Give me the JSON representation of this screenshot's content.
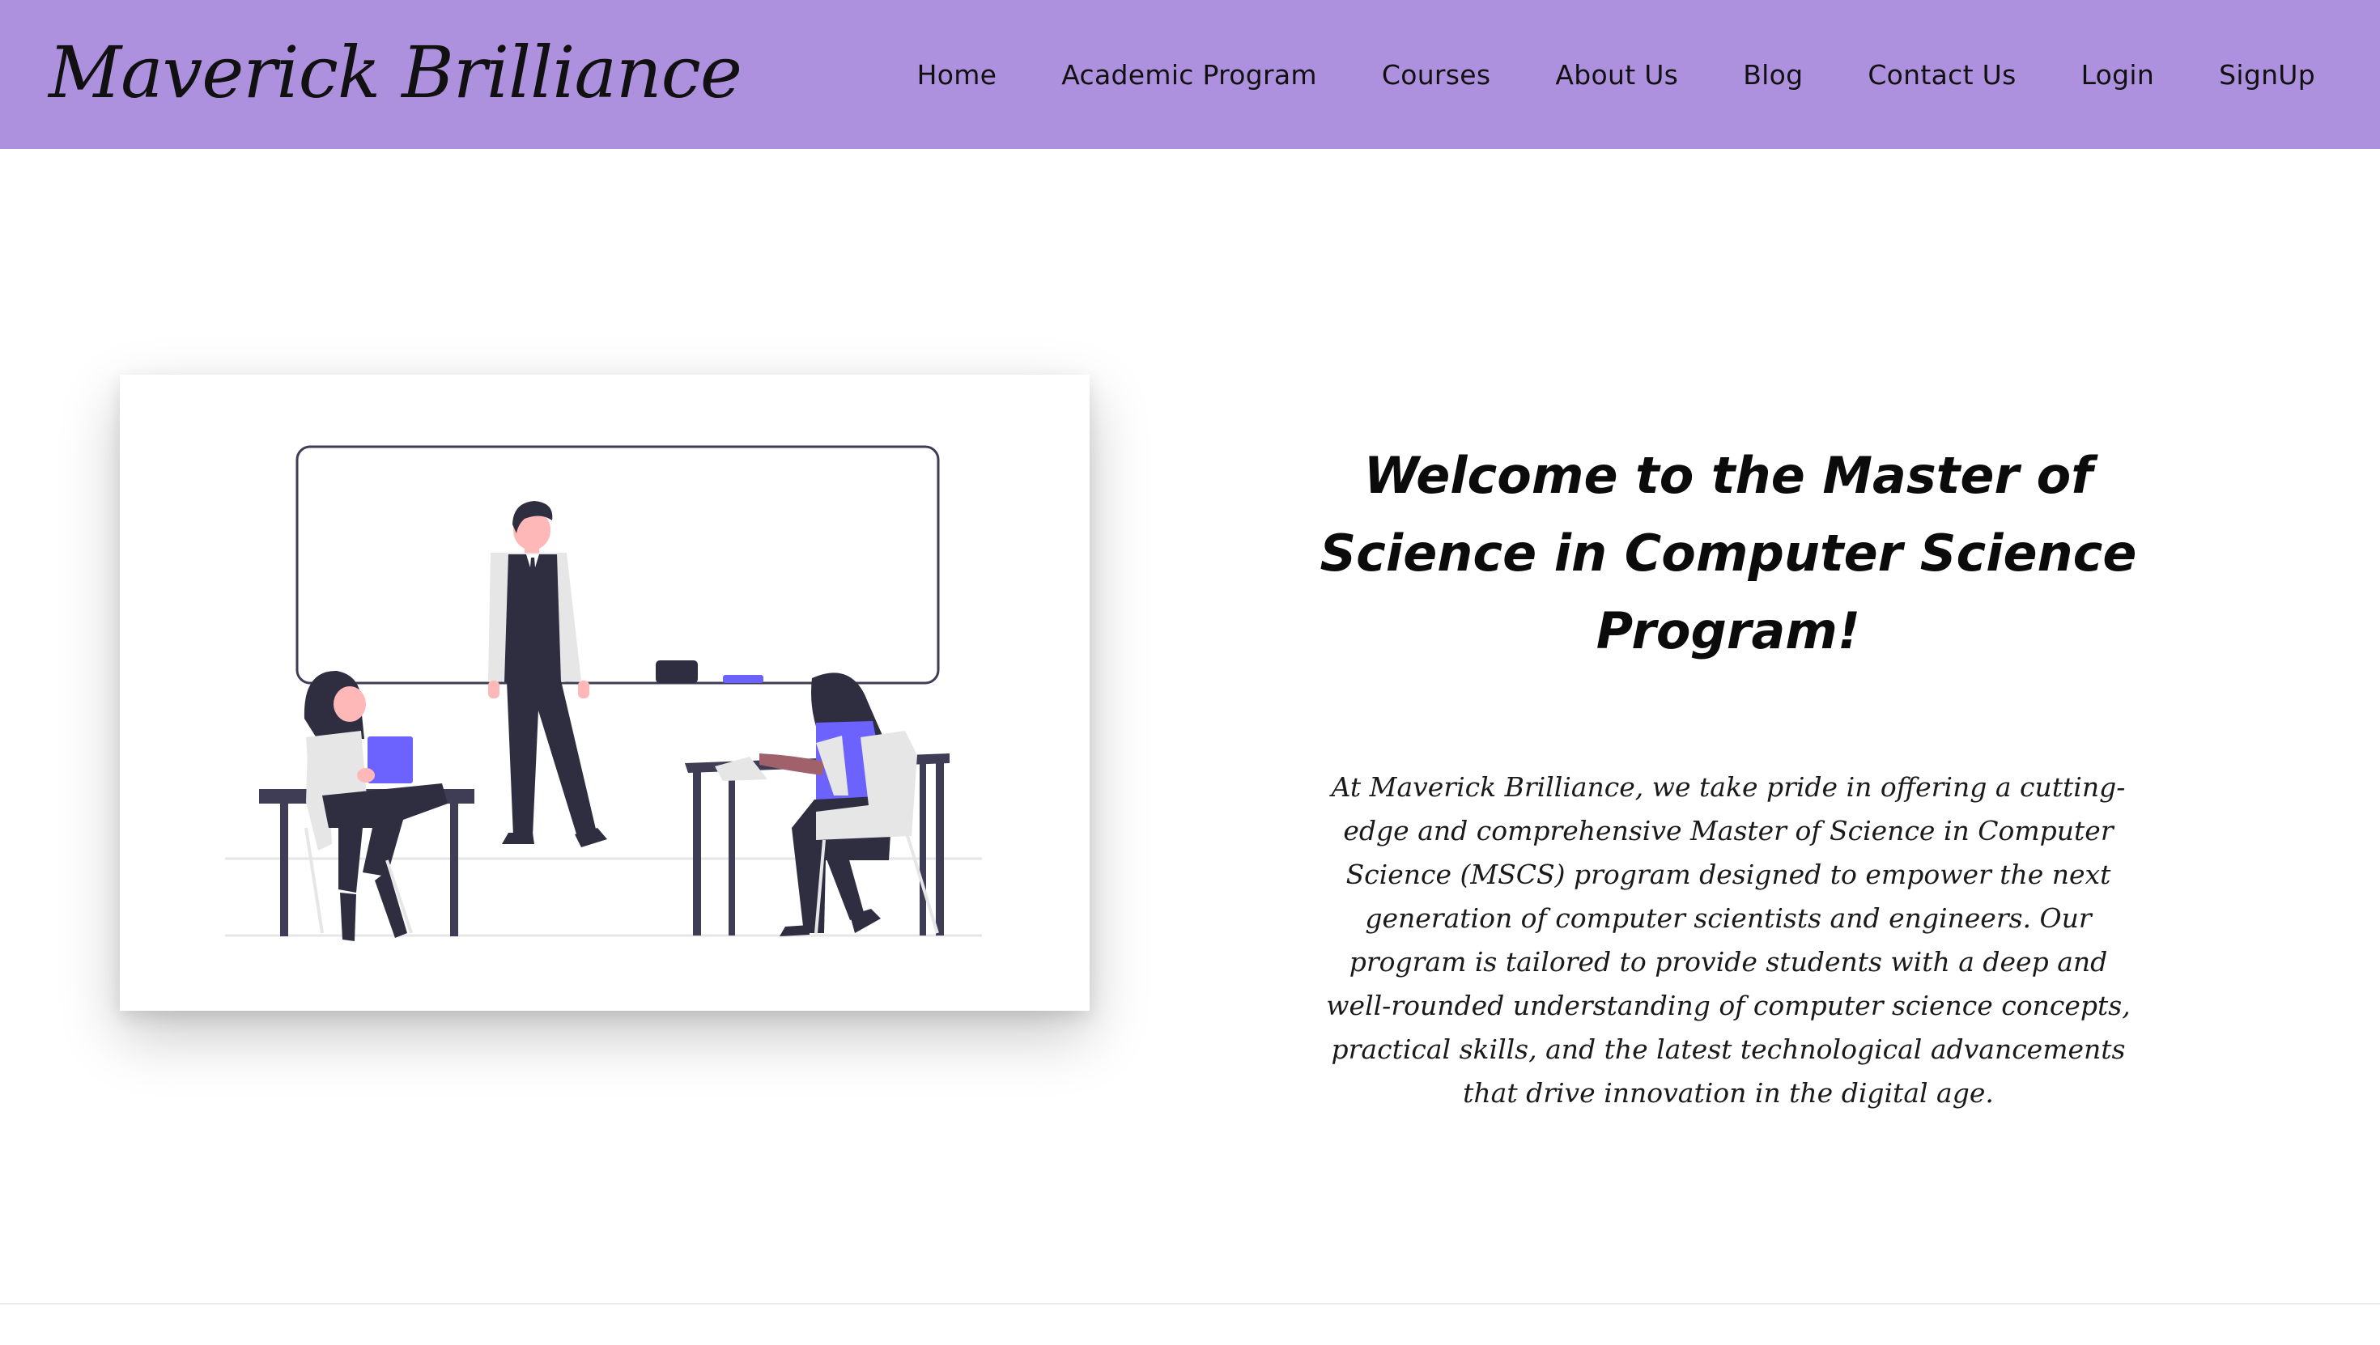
{
  "brand": {
    "name": "Maverick Brilliance"
  },
  "nav": {
    "items": [
      {
        "label": "Home"
      },
      {
        "label": "Academic Program"
      },
      {
        "label": "Courses"
      },
      {
        "label": "About Us"
      },
      {
        "label": "Blog"
      },
      {
        "label": "Contact Us"
      },
      {
        "label": "Login"
      },
      {
        "label": "SignUp"
      }
    ]
  },
  "hero": {
    "title": "Welcome to the Master of Science in Computer Science Program!",
    "body": "At Maverick Brilliance, we take pride in offering a cutting-edge and comprehensive Master of Science in Computer Science (MSCS) program designed to empower the next generation of computer scientists and engineers. Our program is tailored to provide students with a deep and well-rounded understanding of computer science concepts, practical skills, and the latest technological advancements that drive innovation in the digital age."
  },
  "colors": {
    "navbar": "#ae91de",
    "accent": "#6c63ff",
    "dark_figure": "#2f2e41",
    "skin": "#ffb8b8",
    "light_cloth": "#e6e6e6"
  },
  "icons": {
    "illustration": "classroom-illustration"
  }
}
